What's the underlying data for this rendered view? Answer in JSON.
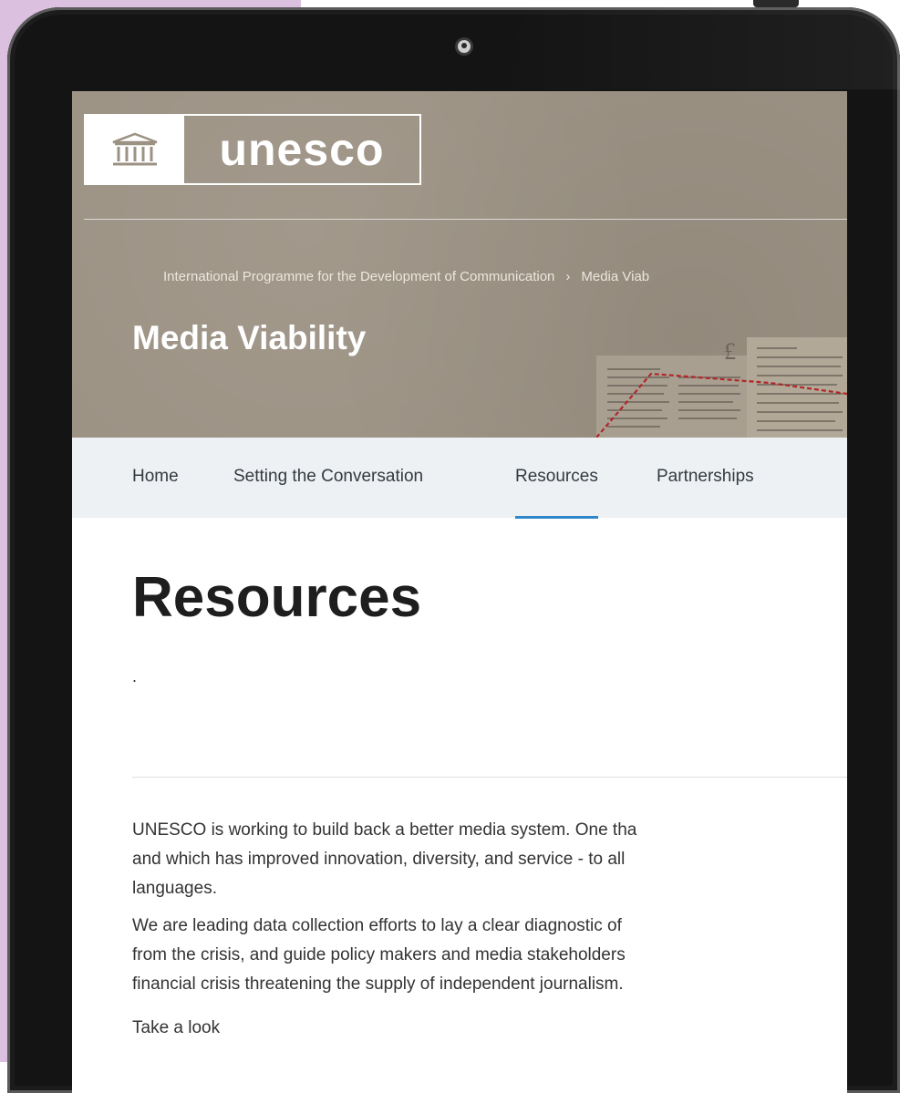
{
  "logo": {
    "wordmark": "unesco"
  },
  "breadcrumb": {
    "items": [
      "International Programme for the Development of Communication",
      "Media Viab"
    ],
    "separator": "›"
  },
  "hero": {
    "title": "Media Viability"
  },
  "nav": {
    "tabs": [
      {
        "label": "Home"
      },
      {
        "label": "Setting the Conversation"
      },
      {
        "label": "Resources",
        "active": true
      },
      {
        "label": "Partnerships"
      }
    ]
  },
  "main": {
    "title": "Resources",
    "dot": ".",
    "paragraphs": [
      [
        "UNESCO is working to build back a better media system.  One tha",
        "and which has improved innovation, diversity, and service - to all",
        "languages."
      ],
      [
        "We are leading data collection efforts to lay a clear diagnostic of",
        "from the crisis, and guide policy makers and media stakeholders",
        "financial crisis threatening the supply of independent journalism."
      ],
      [
        "Take a look"
      ]
    ]
  },
  "colors": {
    "backdrop": "#dcc0df",
    "hero_bg": "#9c9284",
    "tab_bar": "#eef1f4",
    "active_tab_underline": "#2f87c9",
    "device": "#141414"
  },
  "icons": [
    "unesco-temple-icon",
    "device-camera-icon",
    "breadcrumb-chevron-icon"
  ]
}
